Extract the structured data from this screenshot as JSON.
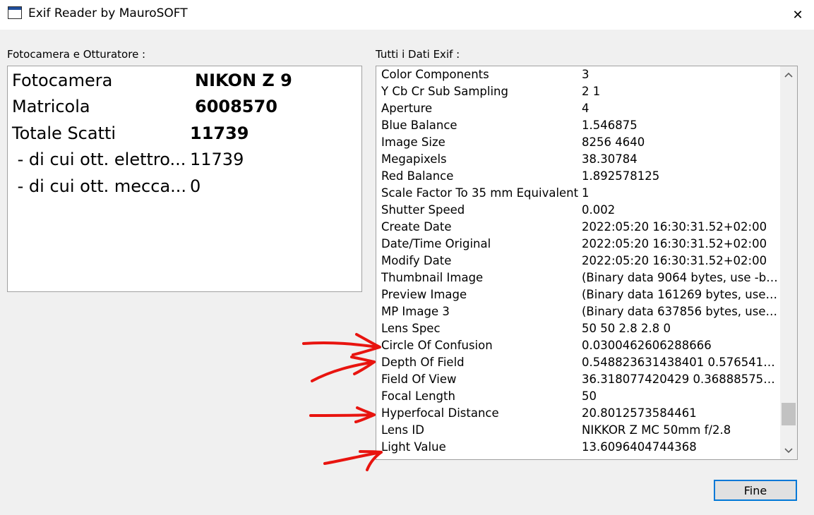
{
  "window": {
    "title": "Exif Reader by MauroSOFT",
    "close_glyph": "✕"
  },
  "camera_group": {
    "label": "Fotocamera e Otturatore :",
    "rows": [
      {
        "label": "Fotocamera",
        "value": "NIKON Z 9"
      },
      {
        "label": "Matricola",
        "value": "6008570"
      },
      {
        "label": "Totale Scatti",
        "value": "11739"
      },
      {
        "label": " - di cui ott. elettro...",
        "value": "11739"
      },
      {
        "label": " - di cui ott. mecca...",
        "value": "0"
      }
    ]
  },
  "exif_group": {
    "label": "Tutti i Dati Exif :",
    "rows": [
      {
        "key": "Color Components",
        "value": "3"
      },
      {
        "key": "Y Cb Cr Sub Sampling",
        "value": "2 1"
      },
      {
        "key": "Aperture",
        "value": "4"
      },
      {
        "key": "Blue Balance",
        "value": "1.546875"
      },
      {
        "key": "Image Size",
        "value": "8256 4640"
      },
      {
        "key": "Megapixels",
        "value": "38.30784"
      },
      {
        "key": "Red Balance",
        "value": "1.892578125"
      },
      {
        "key": "Scale Factor To 35 mm Equivalent",
        "value": "1"
      },
      {
        "key": "Shutter Speed",
        "value": "0.002"
      },
      {
        "key": "Create Date",
        "value": "2022:05:20 16:30:31.52+02:00"
      },
      {
        "key": "Date/Time Original",
        "value": "2022:05:20 16:30:31.52+02:00"
      },
      {
        "key": "Modify Date",
        "value": "2022:05:20 16:30:31.52+02:00"
      },
      {
        "key": "Thumbnail Image",
        "value": "(Binary data 9064 bytes, use -b o..."
      },
      {
        "key": "Preview Image",
        "value": "(Binary data 161269 bytes, use -b..."
      },
      {
        "key": "MP Image 3",
        "value": "(Binary data 637856 bytes, use -b..."
      },
      {
        "key": "Lens Spec",
        "value": "50 50 2.8 2.8 0"
      },
      {
        "key": "Circle Of Confusion",
        "value": "0.0300462606288666"
      },
      {
        "key": "Depth Of Field",
        "value": "0.548823631438401 0.57654172..."
      },
      {
        "key": "Field Of View",
        "value": "36.318077420429 0.3688857541..."
      },
      {
        "key": "Focal Length",
        "value": "50"
      },
      {
        "key": "Hyperfocal Distance",
        "value": "20.8012573584461"
      },
      {
        "key": "Lens ID",
        "value": "NIKKOR Z MC 50mm f/2.8"
      },
      {
        "key": "Light Value",
        "value": "13.6096404744368"
      }
    ]
  },
  "scroll": {
    "position": 0.95
  },
  "buttons": {
    "fine_label": "Fine"
  },
  "colors": {
    "annotation_red": "#e8140f",
    "focus_blue": "#0078d7"
  }
}
